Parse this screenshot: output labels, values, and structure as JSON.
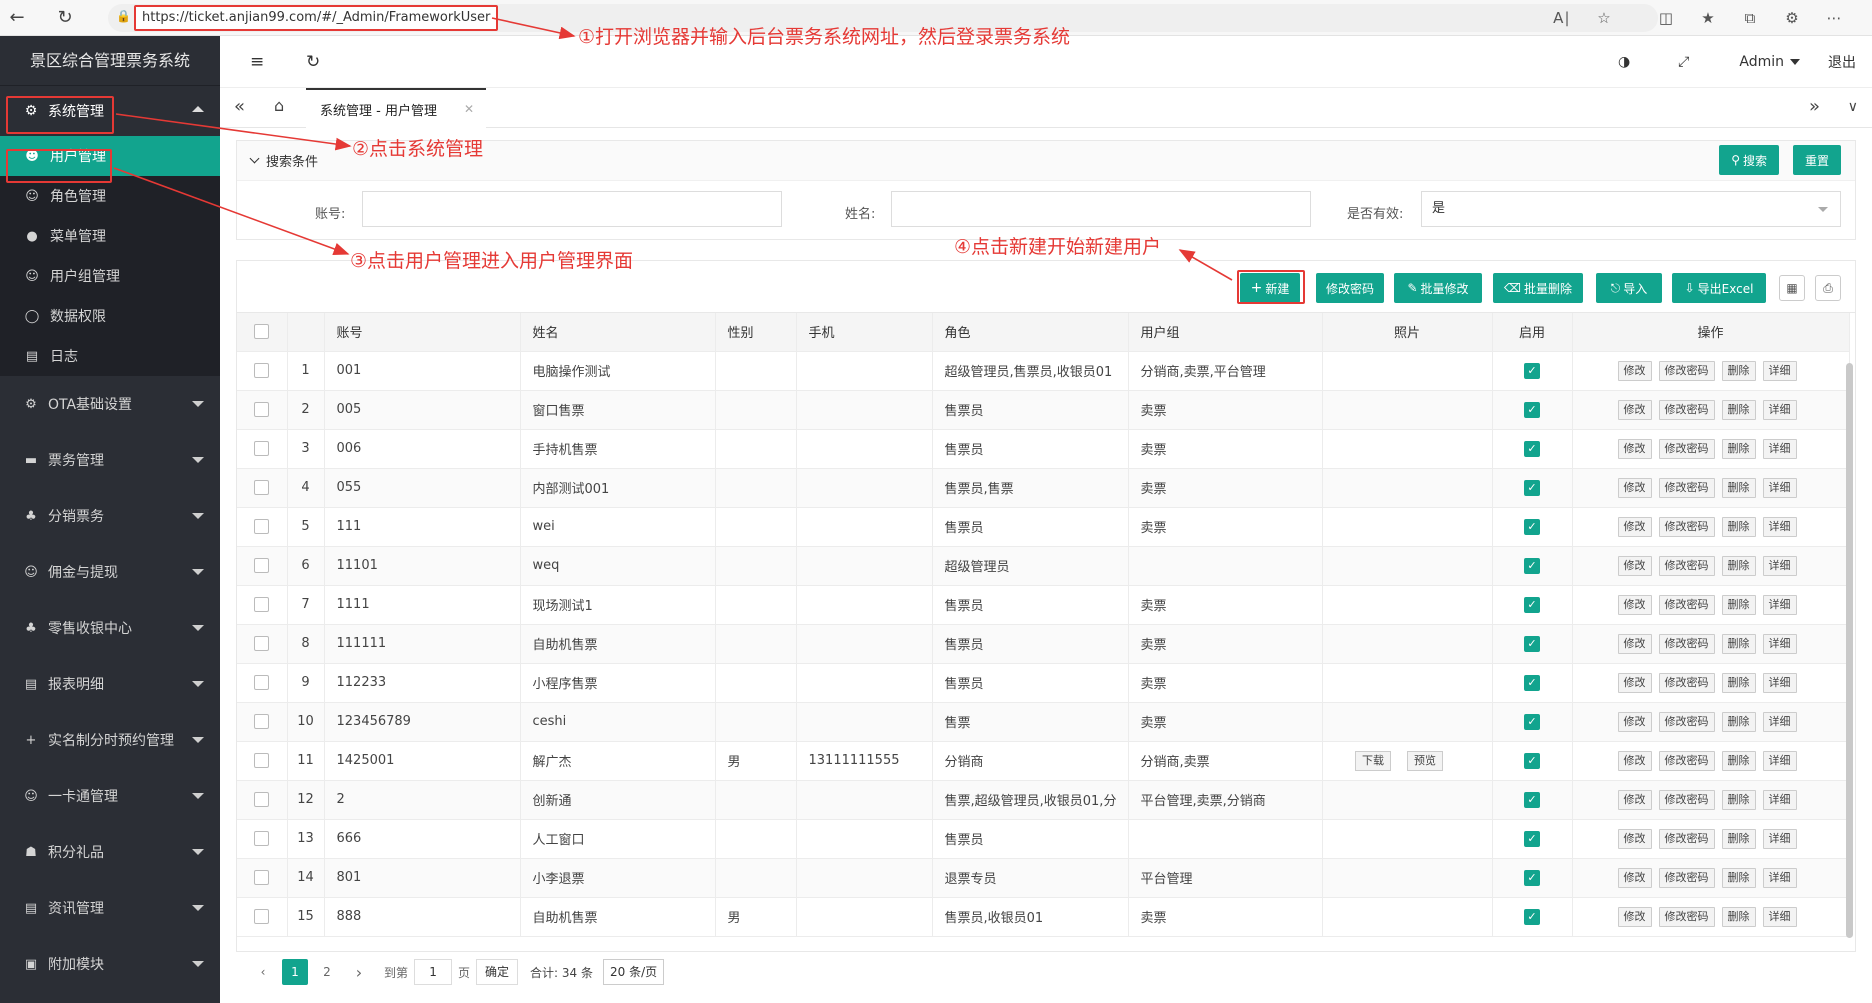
{
  "browser": {
    "url": "https://ticket.anjian99.com/#/_Admin/FrameworkUser"
  },
  "sidebar": {
    "brand": "景区综合管理票务系统",
    "system_menu": "系统管理",
    "sub_items": [
      {
        "label": "用户管理",
        "icon": "user-icon",
        "active": true
      },
      {
        "label": "角色管理",
        "icon": "role-icon"
      },
      {
        "label": "菜单管理",
        "icon": "menu-icon"
      },
      {
        "label": "用户组管理",
        "icon": "user-group-icon"
      },
      {
        "label": "数据权限",
        "icon": "shield-icon"
      },
      {
        "label": "日志",
        "icon": "log-icon"
      }
    ],
    "groups": [
      {
        "label": "OTA基础设置",
        "icon": "gear-icon"
      },
      {
        "label": "票务管理",
        "icon": "ticket-icon"
      },
      {
        "label": "分销票务",
        "icon": "distribution-icon"
      },
      {
        "label": "佣金与提现",
        "icon": "commission-icon"
      },
      {
        "label": "零售收银中心",
        "icon": "cashier-icon"
      },
      {
        "label": "报表明细",
        "icon": "report-icon"
      },
      {
        "label": "实名制分时预约管理",
        "icon": "plus-icon"
      },
      {
        "label": "一卡通管理",
        "icon": "card-icon"
      },
      {
        "label": "积分礼品",
        "icon": "gift-icon"
      },
      {
        "label": "资讯管理",
        "icon": "news-icon"
      },
      {
        "label": "附加模块",
        "icon": "module-icon"
      }
    ]
  },
  "header": {
    "user": "Admin",
    "logout": "退出"
  },
  "tabs": [
    {
      "label": "系统管理 - 用户管理"
    }
  ],
  "search": {
    "title": "搜索条件",
    "search_btn": "搜索",
    "reset_btn": "重置",
    "account_label": "账号:",
    "name_label": "姓名:",
    "valid_label": "是否有效:",
    "valid_value": "是"
  },
  "toolbar": {
    "new_btn": "新建",
    "change_pwd_btn": "修改密码",
    "batch_edit_btn": "批量修改",
    "batch_delete_btn": "批量删除",
    "import_btn": "导入",
    "export_btn": "导出Excel"
  },
  "table": {
    "headers": [
      "账号",
      "姓名",
      "性别",
      "手机",
      "角色",
      "用户组",
      "照片",
      "启用",
      "操作"
    ],
    "row_ops": [
      "修改",
      "修改密码",
      "删除",
      "详细"
    ],
    "photo_ops": [
      "下载",
      "预览"
    ],
    "rows": [
      {
        "no": "1",
        "account": "001",
        "name": "电脑操作测试",
        "gender": "",
        "phone": "",
        "role": "超级管理员,售票员,收银员01",
        "group": "分销商,卖票,平台管理",
        "photo": false
      },
      {
        "no": "2",
        "account": "005",
        "name": "窗口售票",
        "gender": "",
        "phone": "",
        "role": "售票员",
        "group": "卖票",
        "photo": false
      },
      {
        "no": "3",
        "account": "006",
        "name": "手持机售票",
        "gender": "",
        "phone": "",
        "role": "售票员",
        "group": "卖票",
        "photo": false
      },
      {
        "no": "4",
        "account": "055",
        "name": "内部测试001",
        "gender": "",
        "phone": "",
        "role": "售票员,售票",
        "group": "卖票",
        "photo": false
      },
      {
        "no": "5",
        "account": "111",
        "name": "wei",
        "gender": "",
        "phone": "",
        "role": "售票员",
        "group": "卖票",
        "photo": false
      },
      {
        "no": "6",
        "account": "11101",
        "name": "weq",
        "gender": "",
        "phone": "",
        "role": "超级管理员",
        "group": "",
        "photo": false
      },
      {
        "no": "7",
        "account": "1111",
        "name": "现场测试1",
        "gender": "",
        "phone": "",
        "role": "售票员",
        "group": "卖票",
        "photo": false
      },
      {
        "no": "8",
        "account": "111111",
        "name": "自助机售票",
        "gender": "",
        "phone": "",
        "role": "售票员",
        "group": "卖票",
        "photo": false
      },
      {
        "no": "9",
        "account": "112233",
        "name": "小程序售票",
        "gender": "",
        "phone": "",
        "role": "售票员",
        "group": "卖票",
        "photo": false
      },
      {
        "no": "10",
        "account": "123456789",
        "name": "ceshi",
        "gender": "",
        "phone": "",
        "role": "售票",
        "group": "卖票",
        "photo": false
      },
      {
        "no": "11",
        "account": "1425001",
        "name": "解广杰",
        "gender": "男",
        "phone": "13111111555",
        "role": "分销商",
        "group": "分销商,卖票",
        "photo": true
      },
      {
        "no": "12",
        "account": "2",
        "name": "创新通",
        "gender": "",
        "phone": "",
        "role": "售票,超级管理员,收银员01,分",
        "group": "平台管理,卖票,分销商",
        "photo": false
      },
      {
        "no": "13",
        "account": "666",
        "name": "人工窗口",
        "gender": "",
        "phone": "",
        "role": "售票员",
        "group": "",
        "photo": false
      },
      {
        "no": "14",
        "account": "801",
        "name": "小李退票",
        "gender": "",
        "phone": "",
        "role": "退票专员",
        "group": "平台管理",
        "photo": false
      },
      {
        "no": "15",
        "account": "888",
        "name": "自助机售票",
        "gender": "男",
        "phone": "",
        "role": "售票员,收银员01",
        "group": "卖票",
        "photo": false
      }
    ]
  },
  "pager": {
    "page1": "1",
    "page2": "2",
    "goto_label": "到第",
    "goto_value": "1",
    "page_unit": "页",
    "ok": "确定",
    "total": "合计: 34 条",
    "size": "20 条/页"
  },
  "annotations": {
    "step1": "①打开浏览器并输入后台票务系统网址，然后登录票务系统",
    "step2": "②点击系统管理",
    "step3": "③点击用户管理进入用户管理界面",
    "step4": "④点击新建开始新建用户"
  },
  "colors": {
    "accent": "#12a48e",
    "sidebar": "#2b2e35",
    "annotation": "#e53935"
  }
}
